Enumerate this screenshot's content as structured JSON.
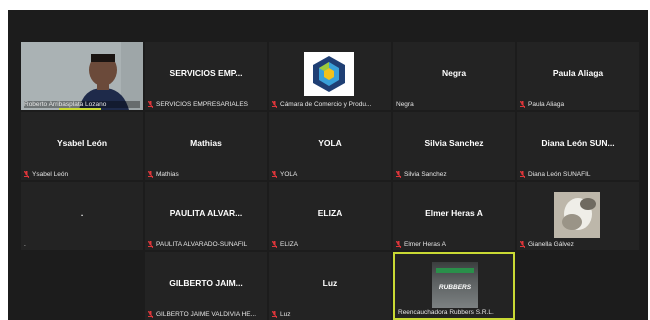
{
  "participants": [
    {
      "id": "roberto",
      "display": "",
      "name": "Roberto Arribasplata Lozano",
      "muted": false,
      "type": "video"
    },
    {
      "id": "servicios",
      "display": "SERVICIOS EMP...",
      "name": "SERVICIOS EMPRESARIALES",
      "muted": true,
      "type": "text"
    },
    {
      "id": "camara",
      "display": "",
      "name": "Cámara de Comercio y Produ...",
      "muted": true,
      "type": "logo"
    },
    {
      "id": "negra",
      "display": "Negra",
      "name": "Negra",
      "muted": false,
      "type": "text"
    },
    {
      "id": "paula",
      "display": "Paula Aliaga",
      "name": "Paula Aliaga",
      "muted": true,
      "type": "text"
    },
    {
      "id": "ysabel",
      "display": "Ysabel León",
      "name": "Ysabel León",
      "muted": true,
      "type": "text"
    },
    {
      "id": "mathias",
      "display": "Mathias",
      "name": "Mathias",
      "muted": true,
      "type": "text"
    },
    {
      "id": "yola",
      "display": "YOLA",
      "name": "YOLA",
      "muted": true,
      "type": "text"
    },
    {
      "id": "silvia",
      "display": "Silvia Sanchez",
      "name": "Silvia Sanchez",
      "muted": true,
      "type": "text"
    },
    {
      "id": "diana",
      "display": "Diana León SUN...",
      "name": "Diana León SUNAFIL",
      "muted": true,
      "type": "text"
    },
    {
      "id": "dot",
      "display": ".",
      "name": ".",
      "muted": false,
      "type": "text"
    },
    {
      "id": "paulita",
      "display": "PAULITA ALVAR...",
      "name": "PAULITA ALVARADO-SUNAFIL",
      "muted": true,
      "type": "text"
    },
    {
      "id": "eliza",
      "display": "ELIZA",
      "name": "ELIZA",
      "muted": true,
      "type": "text"
    },
    {
      "id": "elmer",
      "display": "Elmer Heras A",
      "name": "Elmer Heras A",
      "muted": true,
      "type": "text"
    },
    {
      "id": "gianella",
      "display": "",
      "name": "Gianella Gálvez",
      "muted": true,
      "type": "photo"
    },
    {
      "id": "gilberto",
      "display": "GILBERTO JAIM...",
      "name": "GILBERTO JAIME VALDIVIA HE...",
      "muted": true,
      "type": "text"
    },
    {
      "id": "luz",
      "display": "Luz",
      "name": "Luz",
      "muted": true,
      "type": "text"
    },
    {
      "id": "rubbers",
      "display": "RUBBERS",
      "name": "Reencauchadora Rubbers S.R.L.",
      "muted": false,
      "type": "rubbers"
    }
  ],
  "colors": {
    "muted_icon": "#e0363a",
    "active_border": "#c9d934",
    "tile_bg": "#232323",
    "stage_bg": "#1c1c1c"
  }
}
